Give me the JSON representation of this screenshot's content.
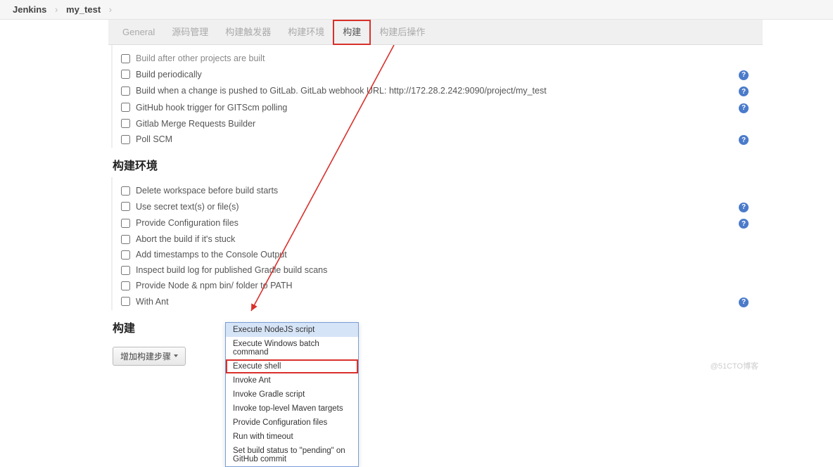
{
  "breadcrumb": {
    "root": "Jenkins",
    "project": "my_test"
  },
  "tabs": {
    "general": "General",
    "scm": "源码管理",
    "triggers": "构建触发器",
    "env": "构建环境",
    "build": "构建",
    "post": "构建后操作"
  },
  "triggers_items": [
    {
      "label": "Build after other projects are built",
      "help": false
    },
    {
      "label": "Build periodically",
      "help": true
    },
    {
      "label": "Build when a change is pushed to GitLab. GitLab webhook URL: http://172.28.2.242:9090/project/my_test",
      "help": true
    },
    {
      "label": "GitHub hook trigger for GITScm polling",
      "help": true
    },
    {
      "label": "Gitlab Merge Requests Builder",
      "help": false
    },
    {
      "label": "Poll SCM",
      "help": true
    }
  ],
  "env_heading": "构建环境",
  "env_items": [
    {
      "label": "Delete workspace before build starts",
      "help": false
    },
    {
      "label": "Use secret text(s) or file(s)",
      "help": true
    },
    {
      "label": "Provide Configuration files",
      "help": true
    },
    {
      "label": "Abort the build if it's stuck",
      "help": false
    },
    {
      "label": "Add timestamps to the Console Output",
      "help": false
    },
    {
      "label": "Inspect build log for published Gradle build scans",
      "help": false
    },
    {
      "label": "Provide Node & npm bin/ folder to PATH",
      "help": false
    },
    {
      "label": "With Ant",
      "help": true
    }
  ],
  "build_heading": "构建",
  "add_step_label": "增加构建步骤",
  "dropdown_items": [
    {
      "label": "Execute NodeJS script",
      "state": "sel"
    },
    {
      "label": "Execute Windows batch command",
      "state": ""
    },
    {
      "label": "Execute shell",
      "state": "boxed"
    },
    {
      "label": "Invoke Ant",
      "state": ""
    },
    {
      "label": "Invoke Gradle script",
      "state": ""
    },
    {
      "label": "Invoke top-level Maven targets",
      "state": ""
    },
    {
      "label": "Provide Configuration files",
      "state": ""
    },
    {
      "label": "Run with timeout",
      "state": ""
    },
    {
      "label": "Set build status to \"pending\" on GitHub commit",
      "state": ""
    }
  ],
  "watermark": "@51CTO博客"
}
